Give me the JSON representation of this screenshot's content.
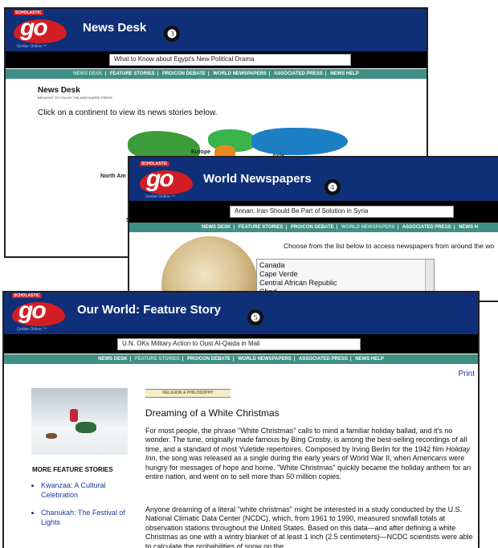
{
  "brand": {
    "logo_text": "go",
    "publisher": "SCHOLASTIC",
    "sublabel": "Grolier Online ™"
  },
  "win1": {
    "title": "News Desk",
    "badge": "❸",
    "ticker": "What to Know about Egypt's New Political Drama",
    "nav": [
      "NEWS DESK",
      "FEATURE STORIES",
      "PRO/CON DEBATE",
      "WORLD NEWSPAPERS",
      "ASSOCIATED PRESS",
      "NEWS HELP"
    ],
    "page_heading": "News Desk",
    "brought_by": "BROUGHT TO YOU BY THE ASSOCIATED PRESS",
    "instruction": "Click on a continent to view its news stories below.",
    "map_labels": {
      "europe": "Europe",
      "north_america": "North Am",
      "asia": "Asia",
      "s": "S"
    }
  },
  "win2": {
    "title": "World Newspapers",
    "badge": "❹",
    "ticker": "Annan: Iran Should Be Part of Solution in Syria",
    "nav": [
      "NEWS DESK",
      "FEATURE STORIES",
      "PRO/CON DEBATE",
      "WORLD NEWSPAPERS",
      "ASSOCIATED PRESS",
      "NEWS H"
    ],
    "instruction": "Choose from the list below to access newspapers from around the wo",
    "countries": [
      "Canada",
      "Cape Verde",
      "Central African Republic",
      "Chad"
    ]
  },
  "win3": {
    "title": "Our World:  Feature Story",
    "badge": "❺",
    "ticker": "U.N. OKs Military Action to Oust Al-Qaida in Mali",
    "nav": [
      "NEWS DESK",
      "FEATURE STORIES",
      "PRO/CON DEBATE",
      "WORLD NEWSPAPERS",
      "ASSOCIATED PRESS",
      "NEWS HELP"
    ],
    "print_label": "Print",
    "category": "RELIGION & PHILOSOPHY",
    "article_title": "Dreaming of a White Christmas",
    "para1_a": "For most people, the phrase \"White Christmas\" calls to mind a familiar holiday ballad, and it's no wonder. The tune, originally made famous by Bing Crosby, is among the best-selling recordings of all time, and a standard of most Yuletide repertoires. Composed by Irving Berlin for the 1942 film ",
    "para1_film": "Holiday Inn",
    "para1_b": ", the song was released as a single during the early years of World War II, when Americans were hungry for messages of hope and home. \"White Christmas\" quickly became the holiday anthem for an entire nation, and went on to sell more than 50 million copies.",
    "para2": "Anyone dreaming of a literal \"white christmas\" might be interested in a study conducted by the U.S. National Climatic Data Center (NCDC), which, from 1961 to 1990, measured snowfall totals at observation stations throughout the United States. Based on this data—and after defining a white Christmas as one with a wintry blanket of at least 1 inch (2.5 centimeters)—NCDC scientists were able to calculate the probabilities of snow on the",
    "more_heading": "MORE FEATURE STORIES",
    "more_items": [
      "Kwanzaa: A Cultural Celebration",
      "Chanukah: The Festival of Lights"
    ]
  }
}
